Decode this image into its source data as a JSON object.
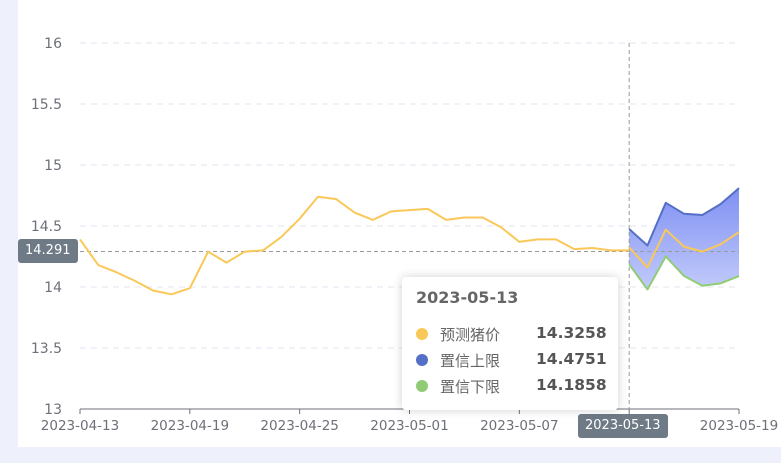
{
  "chart_data": {
    "type": "line",
    "ylim": [
      13,
      16
    ],
    "yticks": [
      "13",
      "13.5",
      "14",
      "14.5",
      "15",
      "15.5",
      "16"
    ],
    "xtick_labels": [
      "2023-04-13",
      "2023-04-19",
      "2023-04-25",
      "2023-05-01",
      "2023-05-07",
      "2023-05-13",
      "2023-05-19"
    ],
    "x_start": "2023-04-13",
    "history": {
      "x": [
        "2023-04-13",
        "2023-04-14",
        "2023-04-15",
        "2023-04-16",
        "2023-04-17",
        "2023-04-18",
        "2023-04-19",
        "2023-04-20",
        "2023-04-21",
        "2023-04-22",
        "2023-04-23",
        "2023-04-24",
        "2023-04-25",
        "2023-04-26",
        "2023-04-27",
        "2023-04-28",
        "2023-04-29",
        "2023-04-30",
        "2023-05-01",
        "2023-05-02",
        "2023-05-03",
        "2023-05-04",
        "2023-05-05",
        "2023-05-06",
        "2023-05-07",
        "2023-05-08",
        "2023-05-09",
        "2023-05-10",
        "2023-05-11",
        "2023-05-12",
        "2023-05-13"
      ],
      "values": [
        14.39,
        14.18,
        14.12,
        14.05,
        13.97,
        13.94,
        13.99,
        14.29,
        14.2,
        14.29,
        14.3,
        14.41,
        14.56,
        14.74,
        14.72,
        14.61,
        14.55,
        14.62,
        14.63,
        14.64,
        14.55,
        14.57,
        14.57,
        14.49,
        14.37,
        14.39,
        14.39,
        14.31,
        14.32,
        14.3,
        14.3
      ]
    },
    "series": [
      {
        "name": "预测猪价",
        "color": "#fac858",
        "x": [
          "2023-05-13",
          "2023-05-14",
          "2023-05-15",
          "2023-05-16",
          "2023-05-17",
          "2023-05-18",
          "2023-05-19"
        ],
        "values": [
          14.3258,
          14.16,
          14.47,
          14.33,
          14.29,
          14.35,
          14.45
        ]
      },
      {
        "name": "置信上限",
        "color": "#5470c6",
        "x": [
          "2023-05-13",
          "2023-05-14",
          "2023-05-15",
          "2023-05-16",
          "2023-05-17",
          "2023-05-18",
          "2023-05-19"
        ],
        "values": [
          14.4751,
          14.34,
          14.69,
          14.6,
          14.59,
          14.68,
          14.81
        ]
      },
      {
        "name": "置信下限",
        "color": "#91cc75",
        "x": [
          "2023-05-13",
          "2023-05-14",
          "2023-05-15",
          "2023-05-16",
          "2023-05-17",
          "2023-05-18",
          "2023-05-19"
        ],
        "values": [
          14.1858,
          13.98,
          14.25,
          14.09,
          14.01,
          14.03,
          14.09
        ]
      }
    ],
    "grid": true
  },
  "axis_pointer": {
    "y_label": "14.291",
    "x_label": "2023-05-13"
  },
  "tooltip": {
    "title": "2023-05-13",
    "rows": [
      {
        "name": "预测猪价",
        "value": "14.3258",
        "color": "#fac858"
      },
      {
        "name": "置信上限",
        "value": "14.4751",
        "color": "#5470c6"
      },
      {
        "name": "置信下限",
        "value": "14.1858",
        "color": "#91cc75"
      }
    ]
  }
}
